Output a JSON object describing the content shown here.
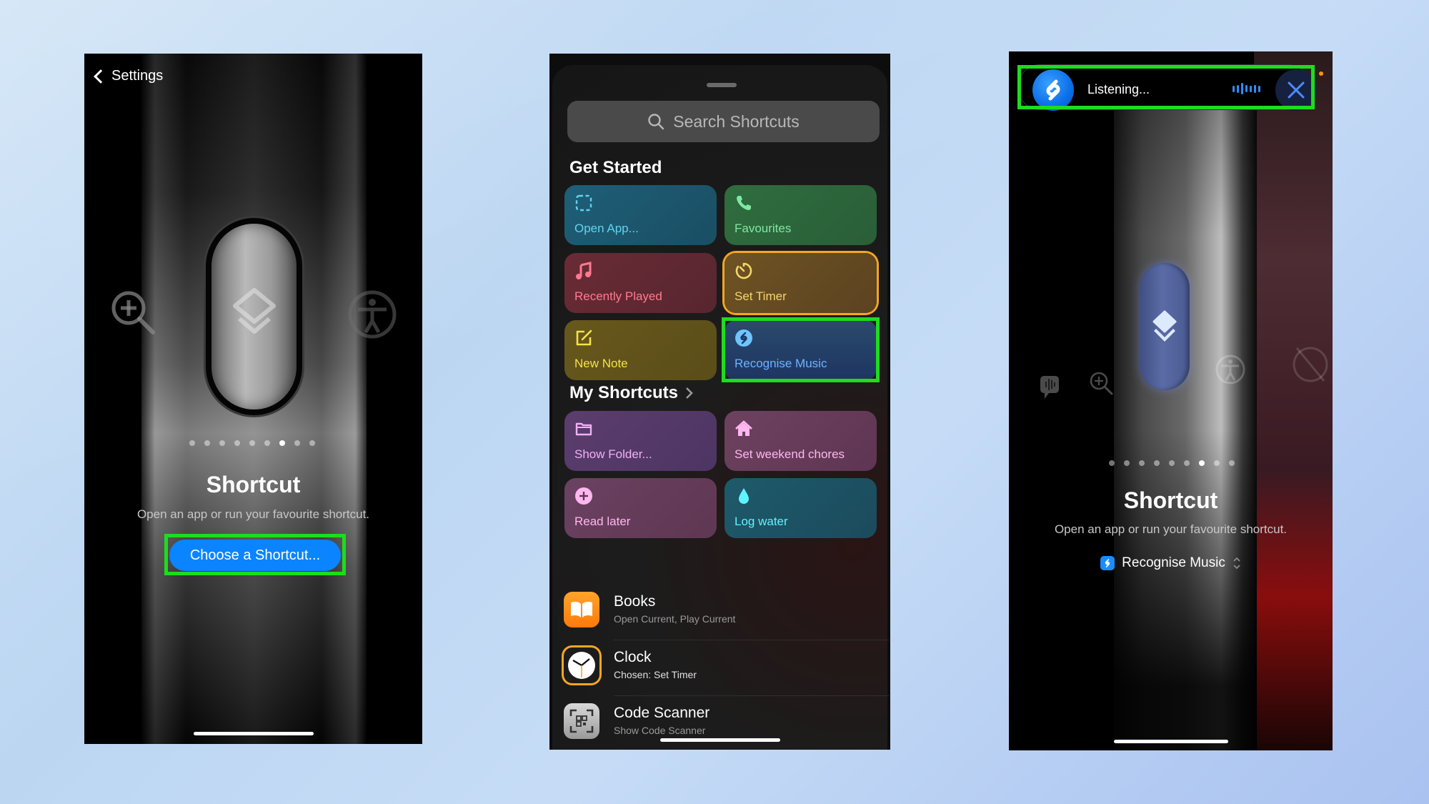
{
  "colors": {
    "highlight": "#1edc1e",
    "accent_blue": "#0a84ff",
    "timer_outline": "#f5a623"
  },
  "phone1": {
    "back_label": "Settings",
    "page_dots": 9,
    "active_dot": 7,
    "title": "Shortcut",
    "subtitle": "Open an app or run your favourite shortcut.",
    "choose_button": "Choose a Shortcut..."
  },
  "phone2": {
    "search_placeholder": "Search Shortcuts",
    "get_started_title": "Get Started",
    "get_started_tiles": [
      {
        "label": "Open App...",
        "icon": "dashed-square-icon",
        "color": "#60d4ec"
      },
      {
        "label": "Favourites",
        "icon": "phone-icon",
        "color": "#7ee8a4"
      },
      {
        "label": "Recently Played",
        "icon": "music-note-icon",
        "color": "#ff7a8f"
      },
      {
        "label": "Set Timer",
        "icon": "timer-icon",
        "color": "#f5d66a"
      },
      {
        "label": "New Note",
        "icon": "compose-icon",
        "color": "#f5e24a"
      },
      {
        "label": "Recognise Music",
        "icon": "shazam-icon",
        "color": "#6fb2ff"
      }
    ],
    "my_shortcuts_title": "My Shortcuts",
    "my_shortcuts_tiles": [
      {
        "label": "Show Folder...",
        "icon": "folder-icon",
        "color": "#f0b0f5"
      },
      {
        "label": "Set weekend chores",
        "icon": "house-icon",
        "color": "#ffb7f0"
      },
      {
        "label": "Read later",
        "icon": "plus-circle-icon",
        "color": "#ffb7f0"
      },
      {
        "label": "Log water",
        "icon": "drop-icon",
        "color": "#5ff3ff"
      }
    ],
    "apps": [
      {
        "name": "Books",
        "sub": "Open Current, Play Current"
      },
      {
        "name": "Clock",
        "sub": "Chosen: Set Timer"
      },
      {
        "name": "Code Scanner",
        "sub": "Show Code Scanner"
      }
    ]
  },
  "phone3": {
    "listening_label": "Listening...",
    "page_dots": 9,
    "active_dot": 7,
    "title": "Shortcut",
    "subtitle": "Open an app or run your favourite shortcut.",
    "selected_shortcut": "Recognise Music"
  }
}
